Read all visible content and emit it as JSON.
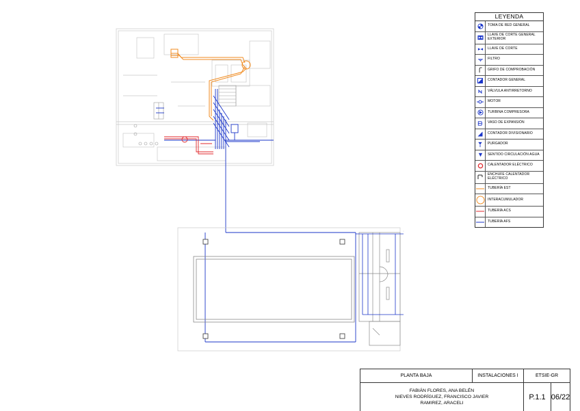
{
  "legend": {
    "title": "LEYENDA",
    "items": [
      {
        "name": "toma",
        "label": "TOMA DE RED GENERAL"
      },
      {
        "name": "llave-exterior",
        "label": "LLAVE DE CORTE GENERAL EXTERIOR"
      },
      {
        "name": "llave",
        "label": "LLAVE DE CORTE"
      },
      {
        "name": "filtro",
        "label": "FILTRO"
      },
      {
        "name": "grifo",
        "label": "GRIFO DE COMPROBACIÓN"
      },
      {
        "name": "contador-general",
        "label": "CONTADOR GENERAL"
      },
      {
        "name": "valvula",
        "label": "VÁLVULA ANTIRRETORNO"
      },
      {
        "name": "motor",
        "label": "MOTOR"
      },
      {
        "name": "turbina",
        "label": "TURBINA COMPRESORA"
      },
      {
        "name": "vaso",
        "label": "VASO DE EXPANSIÓN"
      },
      {
        "name": "contador-div",
        "label": "CONTADOR DIVISIONARIO"
      },
      {
        "name": "purgador",
        "label": "PURGADOR"
      },
      {
        "name": "sentido",
        "label": "SENTIDO CIRCULACIÓN AGUA"
      },
      {
        "name": "calentador",
        "label": "CALENTADOR ELÉCTRICO"
      },
      {
        "name": "enchufe",
        "label": "ENCHUFE CALENTADOR ELÉCTRICO"
      },
      {
        "name": "tuberia-est",
        "label": "TUBERÍA EST"
      },
      {
        "name": "interacumulador",
        "label": "INTERACUMULADOR"
      },
      {
        "name": "tuberia-acs",
        "label": "TUBERÍA ACS"
      },
      {
        "name": "tuberia-afs",
        "label": "TUBERÍA AFS"
      }
    ]
  },
  "title_block": {
    "plan": "PLANTA BAJA",
    "subject": "INSTALACIONES I",
    "school": "ETSIE-GR",
    "authors": [
      "FABIÁN FLORES, ANA BELÉN",
      "NIEVES RODRÍGUEZ, FRANCISCO JAVIER",
      "RAMIREZ, ARACELI"
    ],
    "sheet_code": "P.1.1",
    "date": "06/22"
  },
  "colors": {
    "afs": "#1a35c9",
    "acs": "#e0272b",
    "est": "#f08a1e",
    "walls": "#8a8a8a",
    "light_walls": "#c8c8c8"
  }
}
